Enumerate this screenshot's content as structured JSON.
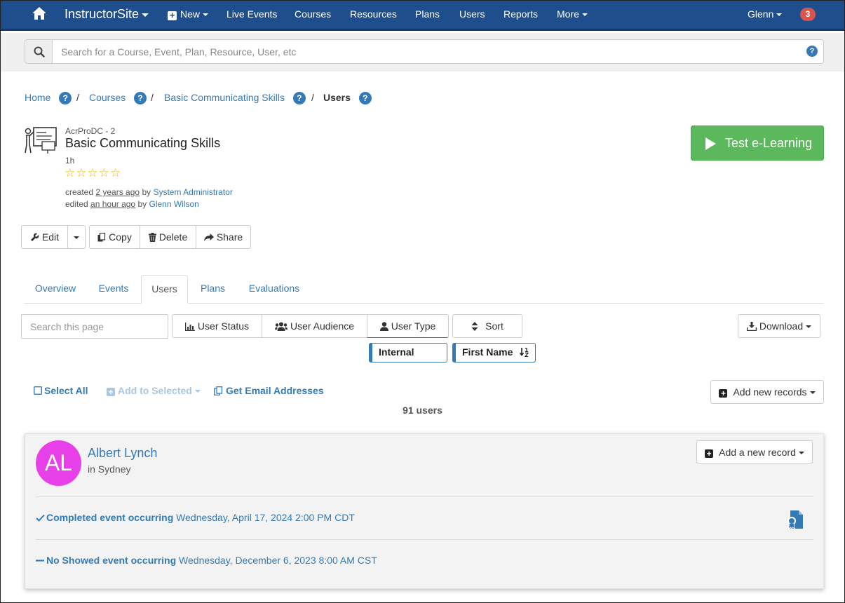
{
  "navbar": {
    "brand": "InstructorSite",
    "new_label": "New",
    "items": [
      "Live Events",
      "Courses",
      "Resources",
      "Plans",
      "Users",
      "Reports",
      "More"
    ],
    "user": "Glenn",
    "notification_count": "3"
  },
  "search": {
    "placeholder": "Search for a Course, Event, Plan, Resource, User, etc"
  },
  "breadcrumb": {
    "items": [
      "Home",
      "Courses",
      "Basic Communicating Skills",
      "Users"
    ],
    "separator": "/"
  },
  "course": {
    "code": "AcrProDC - 2",
    "title": "Basic Communicating Skills",
    "duration": "1h",
    "rating": 0,
    "rating_max": 5,
    "stars": "☆☆☆☆☆",
    "created_prefix": "created",
    "created_ago": "2 years ago",
    "created_by_prefix": "by",
    "created_by": "System Administrator",
    "edited_prefix": "edited",
    "edited_ago": "an hour ago",
    "edited_by_prefix": "by",
    "edited_by": "Glenn Wilson"
  },
  "actions": {
    "test_elearning": "Test e-Learning",
    "edit": "Edit",
    "copy": "Copy",
    "delete": "Delete",
    "share": "Share"
  },
  "tabs": [
    "Overview",
    "Events",
    "Users",
    "Plans",
    "Evaluations"
  ],
  "active_tab": "Users",
  "filters": {
    "search_placeholder": "Search this page",
    "user_status": "User Status",
    "user_audience": "User Audience",
    "user_type": "User Type",
    "sort": "Sort",
    "download": "Download",
    "user_type_chip": "Internal",
    "sort_chip": "First Name"
  },
  "list_actions": {
    "select_all": "Select All",
    "add_to_selected": "Add to Selected",
    "get_emails": "Get Email Addresses",
    "add_new_records": "Add new records"
  },
  "user_count": "91 users",
  "user_card": {
    "initials": "AL",
    "avatar_color": "#e840e8",
    "name": "Albert Lynch",
    "location": "in Sydney",
    "add_record": "Add a new record",
    "events": [
      {
        "status_icon": "check-icon",
        "status": "Completed event occurring",
        "date": "Wednesday, April 17, 2024 2:00 PM CDT"
      },
      {
        "status_icon": "dash-icon",
        "status": "No Showed event occurring",
        "date": "Wednesday, December 6, 2023 8:00 AM CST"
      }
    ]
  },
  "colors": {
    "navbar": "#1f4e8c",
    "link": "#337ab7",
    "success": "#5cb85c",
    "badge": "#d9534f",
    "star": "#f0b400"
  }
}
